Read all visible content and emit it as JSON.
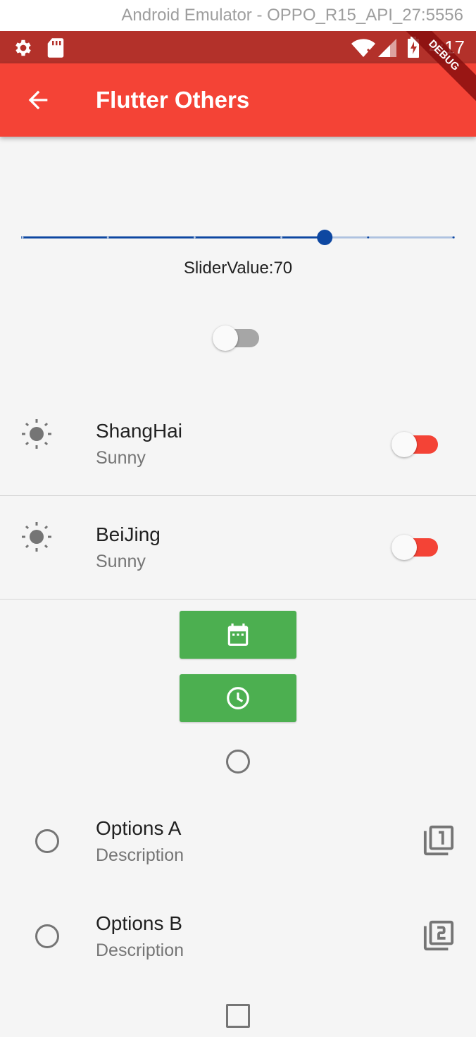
{
  "emulator": {
    "title": "Android Emulator - OPPO_R15_API_27:5556"
  },
  "status_bar": {
    "time": "4:17",
    "background": "#b3312a"
  },
  "debug_banner": {
    "label": "DEBUG"
  },
  "app_bar": {
    "title": "Flutter Others",
    "color": "#f44336"
  },
  "slider": {
    "value": 70,
    "min": 0,
    "max": 100,
    "divisions": 5,
    "label": "SliderValue:70",
    "active_color": "#0d47a1"
  },
  "standalone_switch": {
    "on": false
  },
  "weather_list": [
    {
      "city": "ShangHai",
      "weather": "Sunny",
      "icon": "sunny-icon",
      "switch_on": false
    },
    {
      "city": "BeiJing",
      "weather": "Sunny",
      "icon": "sunny-icon",
      "switch_on": false
    }
  ],
  "buttons": [
    {
      "icon": "calendar-icon",
      "color": "#4caf50"
    },
    {
      "icon": "clock-icon",
      "color": "#4caf50"
    }
  ],
  "standalone_radio": {
    "selected": false
  },
  "options": [
    {
      "title": "Options A",
      "subtitle": "Description",
      "icon": "filter-1-icon",
      "selected": false
    },
    {
      "title": "Options B",
      "subtitle": "Description",
      "icon": "filter-2-icon",
      "selected": false
    }
  ],
  "checkbox": {
    "checked": false
  }
}
